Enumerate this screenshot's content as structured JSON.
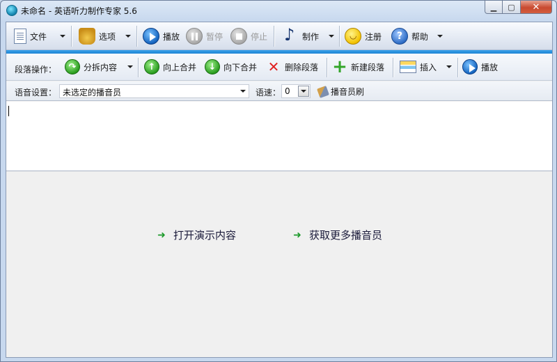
{
  "window": {
    "title": "未命名 - 英语听力制作专家 5.6"
  },
  "toolbar": {
    "file": "文件",
    "options": "选项",
    "play": "播放",
    "pause": "暂停",
    "stop": "停止",
    "make": "制作",
    "register": "注册",
    "help": "帮助"
  },
  "paragraph_bar": {
    "label": "段落操作：",
    "split": "分拆内容",
    "merge_up": "向上合并",
    "merge_down": "向下合并",
    "delete": "删除段落",
    "new": "新建段落",
    "insert": "插入",
    "play": "播放"
  },
  "voice_bar": {
    "label": "语音设置：",
    "announcer_value": "未选定的播音员",
    "speed_label": "语速：",
    "speed_value": "0",
    "brush": "播音员刷"
  },
  "links": {
    "open_demo": "打开演示内容",
    "get_more": "获取更多播音员"
  },
  "colors": {
    "accent_bar": "#1e84d4"
  }
}
